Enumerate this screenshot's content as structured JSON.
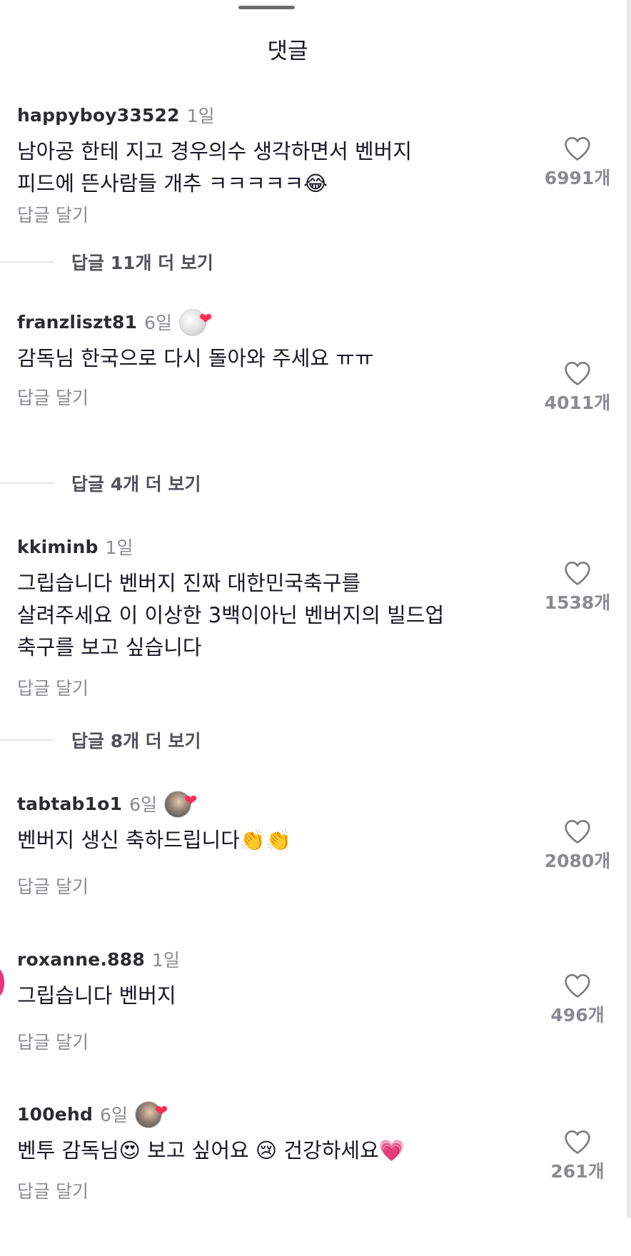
{
  "sheet": {
    "title": "댓글"
  },
  "comments": [
    {
      "username": "happyboy33522",
      "time": "1일",
      "creator_liked": false,
      "text": "남아공 한테 지고 경우의수 생각하면서 벤버지\n피드에 뜬사람들 개추 ㅋㅋㅋㅋㅋ😂",
      "likes": "6991개",
      "reply_label": "답글 달기",
      "more_replies": "답글 11개 더 보기"
    },
    {
      "username": "franzliszt81",
      "time": "6일",
      "creator_liked": true,
      "text": "감독님 한국으로 다시 돌아와 주세요 ㅠㅠ",
      "likes": "4011개",
      "reply_label": "답글 달기",
      "more_replies": "답글 4개 더 보기"
    },
    {
      "username": "kkiminb",
      "time": "1일",
      "creator_liked": false,
      "text": "그립습니다 벤버지 진짜 대한민국축구를\n살려주세요 이 이상한 3백이아닌 벤버지의 빌드업\n축구를 보고 싶습니다",
      "likes": "1538개",
      "reply_label": "답글 달기",
      "more_replies": "답글 8개 더 보기"
    },
    {
      "username": "tabtab1o1",
      "time": "6일",
      "creator_liked": true,
      "text": "벤버지 생신 축하드립니다👏👏",
      "likes": "2080개",
      "reply_label": "답글 달기"
    },
    {
      "username": "roxanne.888",
      "time": "1일",
      "creator_liked": false,
      "text": "그립습니다 벤버지",
      "likes": "496개",
      "reply_label": "답글 달기"
    },
    {
      "username": "100ehd",
      "time": "6일",
      "creator_liked": true,
      "text": "벤투 감독님😍 보고 싶어요 😢 건강하세요💗",
      "likes": "261개",
      "reply_label": "답글 달기"
    }
  ],
  "icons": {
    "like": "heart-outline-icon",
    "creator_heart": "heart-filled-icon"
  },
  "colors": {
    "accent": "#fe2c55",
    "text": "#161823",
    "secondary": "#8a8b91"
  }
}
